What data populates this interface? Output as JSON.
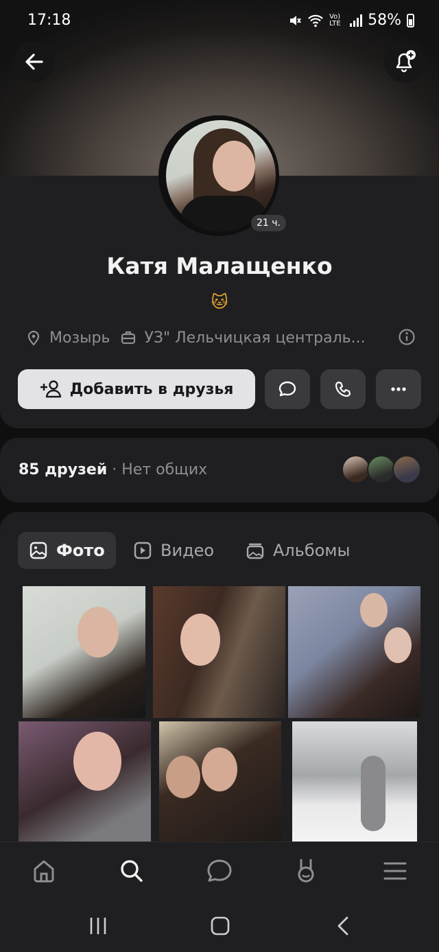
{
  "status_bar": {
    "time": "17:18",
    "battery": "58%",
    "network": "Vo) LTE"
  },
  "header": {
    "back_icon": "arrow-left-icon",
    "subscribe_icon": "bell-plus-icon"
  },
  "profile": {
    "name": "Катя Малащенко",
    "status_emoji": "🐱",
    "last_seen": "21 ч.",
    "city": "Мозырь",
    "work": "УЗ\" Лельчицкая централь...",
    "add_friend_label": "Добавить в друзья"
  },
  "friends": {
    "count_label": "85 друзей",
    "mutual_label": "· Нет общих"
  },
  "media_tabs": [
    {
      "label": "Фото",
      "icon": "image-icon",
      "active": true
    },
    {
      "label": "Видео",
      "icon": "play-icon",
      "active": false
    },
    {
      "label": "Альбомы",
      "icon": "albums-icon",
      "active": false
    }
  ],
  "bottom_nav": [
    "home-icon",
    "search-icon",
    "messages-icon",
    "clips-icon",
    "menu-icon"
  ],
  "colors": {
    "background": "#0f0f10",
    "card": "#1f1f21",
    "button_light": "#e3e3e6",
    "button_dark": "#3a3a3d",
    "text_secondary": "#8f8f93"
  }
}
